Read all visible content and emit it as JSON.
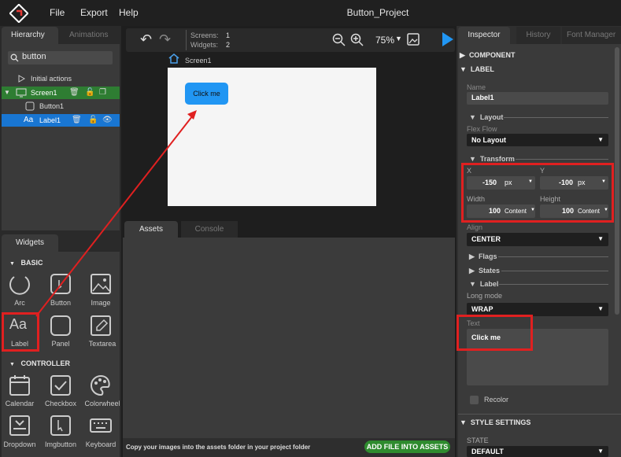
{
  "menubar": {
    "items": [
      "File",
      "Export",
      "Help"
    ],
    "title": "Button_Project"
  },
  "hierarchy": {
    "tabs": [
      "Hierarchy",
      "Animations"
    ],
    "search": "button",
    "rows": [
      "Initial actions",
      "Screen1",
      "Button1",
      "Label1"
    ]
  },
  "widgets": {
    "tab": "Widgets",
    "basic_header": "BASIC",
    "basic": [
      "Arc",
      "Button",
      "Image",
      "Label",
      "Panel",
      "Textarea"
    ],
    "controller_header": "CONTROLLER",
    "controller": [
      "Calendar",
      "Checkbox",
      "Colorwheel",
      "Dropdown",
      "Imgbutton",
      "Keyboard"
    ]
  },
  "toolbar": {
    "screens_label": "Screens:",
    "screens": "1",
    "widgets_label": "Widgets:",
    "widgets": "2",
    "zoom": "75%"
  },
  "canvas": {
    "screen_name": "Screen1",
    "button_text": "Click me"
  },
  "assets": {
    "tabs": [
      "Assets",
      "Console"
    ],
    "hint": "Copy your images into the assets folder in your project folder",
    "add_button": "ADD FILE INTO ASSETS"
  },
  "inspector": {
    "tabs": [
      "Inspector",
      "History",
      "Font Manager"
    ],
    "component": "COMPONENT",
    "label_section": "LABEL",
    "name_label": "Name",
    "name_value": "Label1",
    "layout": "Layout",
    "flex_flow_label": "Flex Flow",
    "flex_flow": "No Layout",
    "transform": "Transform",
    "x_label": "X",
    "x_value": "-150",
    "x_unit": "px",
    "y_label": "Y",
    "y_value": "-100",
    "y_unit": "px",
    "width_label": "Width",
    "width_value": "100",
    "width_unit": "Content",
    "height_label": "Height",
    "height_value": "100",
    "height_unit": "Content",
    "align_label": "Align",
    "align_value": "CENTER",
    "flags": "Flags",
    "states": "States",
    "label_sub": "Label",
    "long_mode_label": "Long mode",
    "long_mode": "WRAP",
    "text_label": "Text",
    "text_value": "Click me",
    "recolor": "Recolor",
    "style_settings": "STYLE SETTINGS",
    "state_label": "STATE",
    "state_value": "DEFAULT"
  },
  "colors": {
    "accent": "#2196f3",
    "highlight": "#e02020",
    "screen_row": "#2e7d32",
    "label_row": "#1976d2",
    "add_button": "#2e8b2e"
  }
}
